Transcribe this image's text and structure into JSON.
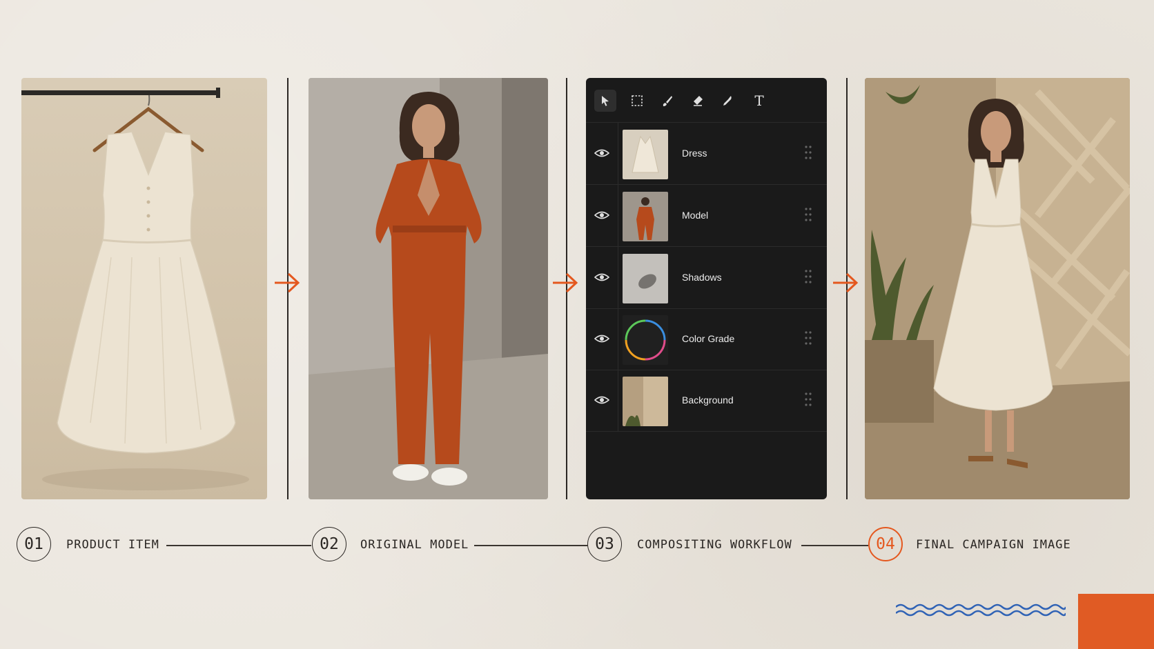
{
  "steps": [
    {
      "number": "01",
      "label": "PRODUCT ITEM"
    },
    {
      "number": "02",
      "label": "ORIGINAL MODEL"
    },
    {
      "number": "03",
      "label": "COMPOSITING WORKFLOW"
    },
    {
      "number": "04",
      "label": "FINAL CAMPAIGN IMAGE"
    }
  ],
  "layers_panel": {
    "tools": [
      "select-arrow-icon",
      "marquee-select-icon",
      "brush-icon",
      "eraser-icon",
      "pen-tool-icon",
      "text-tool-icon"
    ],
    "tool_text_glyph": "T",
    "layers": [
      {
        "name": "Dress",
        "visible": true
      },
      {
        "name": "Model",
        "visible": true
      },
      {
        "name": "Shadows",
        "visible": true
      },
      {
        "name": "Color Grade",
        "visible": true
      },
      {
        "name": "Background",
        "visible": true
      }
    ]
  },
  "colors": {
    "accent": "#e4581f",
    "background": "#ebe6de",
    "panel_dark": "#1a1a1a",
    "ink": "#2a2623",
    "wave": "#2f62b5"
  }
}
